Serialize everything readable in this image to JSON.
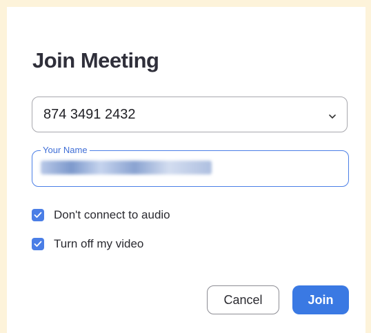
{
  "dialog": {
    "title": "Join Meeting",
    "meeting_id": {
      "value": "874 3491 2432",
      "dropdown_icon": "chevron-down-icon"
    },
    "name_field": {
      "label": "Your Name",
      "value": ""
    },
    "options": [
      {
        "label": "Don't connect to audio",
        "checked": true
      },
      {
        "label": "Turn off my video",
        "checked": true
      }
    ],
    "buttons": {
      "cancel": "Cancel",
      "join": "Join"
    }
  },
  "colors": {
    "accent": "#3a79e3",
    "background": "#fdf3da"
  }
}
